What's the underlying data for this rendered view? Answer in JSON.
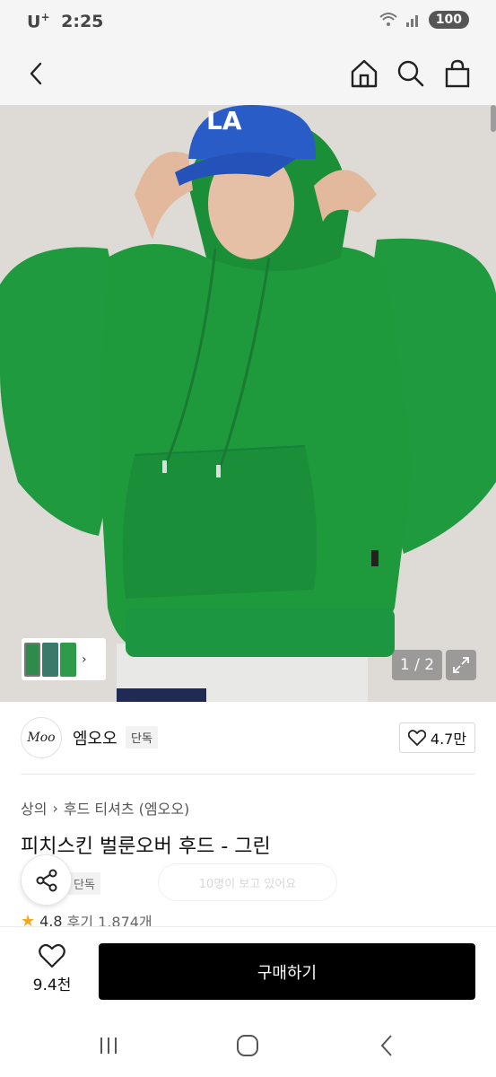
{
  "status_bar": {
    "carrier": "U",
    "carrier_sup": "+",
    "time": "2:25",
    "battery": "100"
  },
  "header": {
    "icons": [
      "back-arrow-icon",
      "home-icon",
      "search-icon",
      "shopping-bag-icon"
    ]
  },
  "gallery": {
    "counter": "1 / 2",
    "thumbnail_colors": [
      "#2e8b4a",
      "#3a7a6a",
      "#2e9b4a"
    ],
    "background_color": "#dedbd6",
    "hoodie_color": "#1f9a3e",
    "cap_color": "#2a5cc8"
  },
  "brand": {
    "logo_text": "Moo",
    "name": "엠오오",
    "badge": "단독",
    "likes": "4.7만"
  },
  "breadcrumb": {
    "category": "상의",
    "subcategory": "후드 티셔츠 (엠오오)"
  },
  "product": {
    "title": "피치스킨 벌룬오버 후드 - 그린",
    "partial_badge": "단독",
    "faded_pill": "10명이 보고 있어요",
    "rating": "4.8",
    "reviews": "후기 1,874개"
  },
  "bottom_bar": {
    "wish_count": "9.4천",
    "buy_label": "구매하기"
  },
  "colors": {
    "accent": "#000000",
    "star": "#f5a623"
  }
}
